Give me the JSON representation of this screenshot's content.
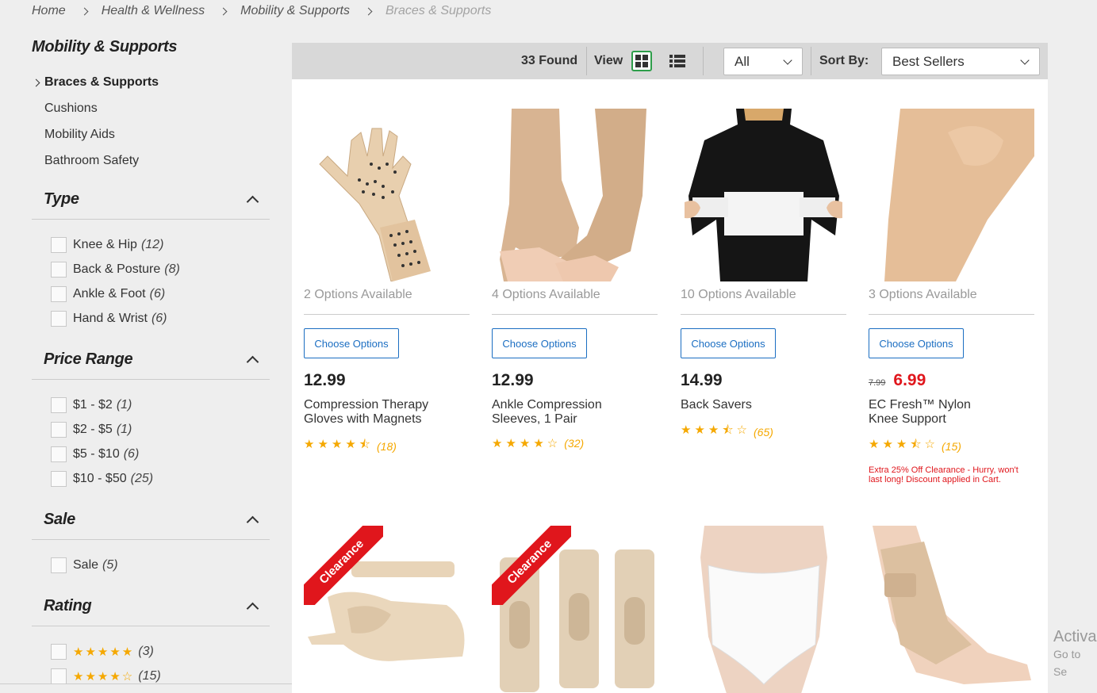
{
  "breadcrumb": [
    "Home",
    "Health & Wellness",
    "Mobility & Supports",
    "Braces & Supports"
  ],
  "sidebar": {
    "category_title": "Mobility & Supports",
    "subcategories": [
      "Braces & Supports",
      "Cushions",
      "Mobility Aids",
      "Bathroom Safety"
    ],
    "facets": {
      "type": {
        "title": "Type",
        "options": [
          {
            "label": "Knee & Hip",
            "count": "(12)"
          },
          {
            "label": "Back & Posture",
            "count": "(8)"
          },
          {
            "label": "Ankle & Foot",
            "count": "(6)"
          },
          {
            "label": "Hand & Wrist",
            "count": "(6)"
          }
        ]
      },
      "price_range": {
        "title": "Price Range",
        "options": [
          {
            "label": "$1 - $2",
            "count": "(1)"
          },
          {
            "label": "$2 - $5",
            "count": "(1)"
          },
          {
            "label": "$5 - $10",
            "count": "(6)"
          },
          {
            "label": "$10 - $50",
            "count": "(25)"
          }
        ]
      },
      "sale": {
        "title": "Sale",
        "options": [
          {
            "label": "Sale",
            "count": "(5)"
          }
        ]
      },
      "rating": {
        "title": "Rating",
        "options": [
          {
            "stars": "★★★★★",
            "count": "(3)"
          },
          {
            "stars": "★★★★☆",
            "count": "(15)"
          }
        ]
      }
    }
  },
  "toolbar": {
    "found": "33 Found",
    "view_label": "View",
    "filter_value": "All",
    "sort_label": "Sort By:",
    "sort_value": "Best Sellers"
  },
  "products": [
    {
      "options": "2 Options Available",
      "button": "Choose Options",
      "price": "12.99",
      "old_price": "",
      "name_line1": "Compression Therapy",
      "name_line2": "Gloves with Magnets",
      "stars": "★★★★⯪",
      "rating_count": "(18)",
      "promo_line1": "",
      "promo_line2": ""
    },
    {
      "options": "4 Options Available",
      "button": "Choose Options",
      "price": "12.99",
      "old_price": "",
      "name_line1": "Ankle Compression",
      "name_line2": "Sleeves, 1 Pair",
      "stars": "★★★★☆",
      "rating_count": "(32)",
      "promo_line1": "",
      "promo_line2": ""
    },
    {
      "options": "10 Options Available",
      "button": "Choose Options",
      "price": "14.99",
      "old_price": "",
      "name_line1": "Back Savers",
      "name_line2": "",
      "stars": "★★★⯪☆",
      "rating_count": "(65)",
      "promo_line1": "",
      "promo_line2": ""
    },
    {
      "options": "3 Options Available",
      "button": "Choose Options",
      "price": "6.99",
      "old_price": "7.99",
      "name_line1": "EC Fresh™ Nylon",
      "name_line2": "Knee Support",
      "stars": "★★★⯪☆",
      "rating_count": "(15)",
      "promo_line1": "Extra 25% Off Clearance - Hurry, won't",
      "promo_line2": "last long! Discount applied in Cart."
    }
  ],
  "ribbon_text": "Clearance",
  "watermark": {
    "line1": "Activa",
    "line2": "Go to Se"
  },
  "colors": {
    "accent_green": "#2e9e4a",
    "link_blue": "#1b6ec2",
    "sale_red": "#e0161c",
    "star_gold": "#f5a800"
  }
}
